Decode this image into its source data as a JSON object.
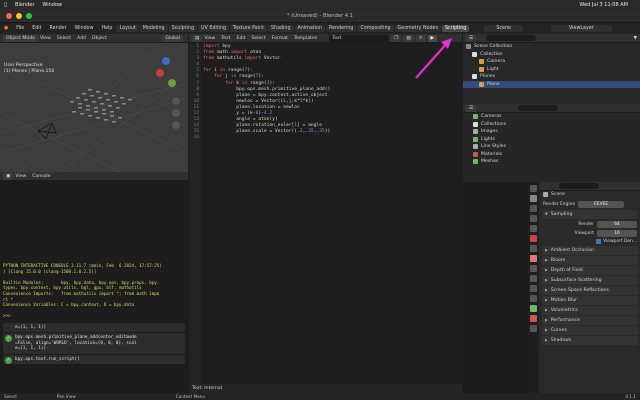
{
  "mac_menu": {
    "apple": "",
    "app": "Blender",
    "window": "Window",
    "clock": "Wed Jul 3  11:08 AM"
  },
  "window_title": "* (Unsaved) - Blender 4.1",
  "top_menu": [
    "File",
    "Edit",
    "Render",
    "Window",
    "Help"
  ],
  "workspaces": [
    "Layout",
    "Modeling",
    "Sculpting",
    "UV Editing",
    "Texture Paint",
    "Shading",
    "Animation",
    "Rendering",
    "Compositing",
    "Geometry Nodes",
    "Scripting"
  ],
  "active_workspace": "Scripting",
  "scene_name": "Scene",
  "view_layer": "ViewLayer",
  "viewport": {
    "mode": "Object Mode",
    "menus": [
      "View",
      "Select",
      "Add",
      "Object"
    ],
    "transform": "Global",
    "overlay_title": "User Perspective",
    "overlay_sub": "(1) Planes | Plane.156"
  },
  "console": {
    "menus": [
      "View",
      "Console"
    ],
    "output": "PYTHON INTERACTIVE CONSOLE 3.11.7 (main, Feb  6 2024, 17:57:25)\n) [Clang 15.0.0 (clang-1500.1.0.2.5)]\n\nBuiltin Modules:       bpy, bpy.data, bpy.ops, bpy.props, bpy.\ntypes, bpy.context, bpy.utils, bgl, gpu, blf, mathutils\nConvenience Imports:   from mathutils import *; from math impo\nrt *\nConvenience Variables: C = bpy.context, D = bpy.data\n\n>>> ",
    "reports": [
      "e=(1, 1, 1))",
      "bpy.ops.mesh.primitive_plane_add(enter_editmode\n=False, align='WORLD', location=(0, 0, 0), scal\ne=(1, 1, 1))",
      "bpy.ops.text.run_script()"
    ]
  },
  "text_editor": {
    "menus": [
      "View",
      "Text",
      "Edit",
      "Select",
      "Format",
      "Templates"
    ],
    "text_name": "Text",
    "footer": "Text: Internal",
    "lines": [
      "import bpy",
      "from math import atan",
      "from mathutils import Vector",
      "",
      "for i in range(7):",
      "    for j in range(7):",
      "        for k in range(3):",
      "            bpy.ops.mesh.primitive_plane_add()",
      "            plane = bpy.context.active_object",
      "            newloc = Vector((i,j,k*5*k))",
      "            plane.location = newloc",
      "            y = (k-0)-4.2",
      "            angle = atan(y)",
      "            plane.rotation_euler[1] = angle",
      "            plane.scale = Vector((.2,.35,.35))",
      ""
    ]
  },
  "outliner": {
    "title": "Scene Collection",
    "items": [
      "Collection",
      "Camera",
      "Light",
      "Planes",
      "Plane"
    ],
    "data_items": [
      "Cameras",
      "Collections",
      "Images",
      "Lights",
      "Line Styles",
      "Materials",
      "Meshes"
    ]
  },
  "properties": {
    "scene": "Scene",
    "render_engine_label": "Render Engine",
    "render_engine": "EEVEE",
    "sampling": "Sampling",
    "render_label": "Render",
    "render_value": "64",
    "viewport_label": "Viewport",
    "viewport_value": "16",
    "viewport_denoise": "Viewport Den...",
    "panels": [
      "Ambient Occlusion",
      "Bloom",
      "Depth of Field",
      "Subsurface Scattering",
      "Screen Space Reflections",
      "Motion Blur",
      "Volumetrics",
      "Performance",
      "Curves",
      "Shadows"
    ]
  },
  "statusbar": {
    "left": "Select",
    "middle": "Pan View",
    "right": "Context Menu",
    "version": "4.1.1"
  },
  "colors": {
    "accent": "#e32ed4",
    "play_button": "#ffffff"
  }
}
